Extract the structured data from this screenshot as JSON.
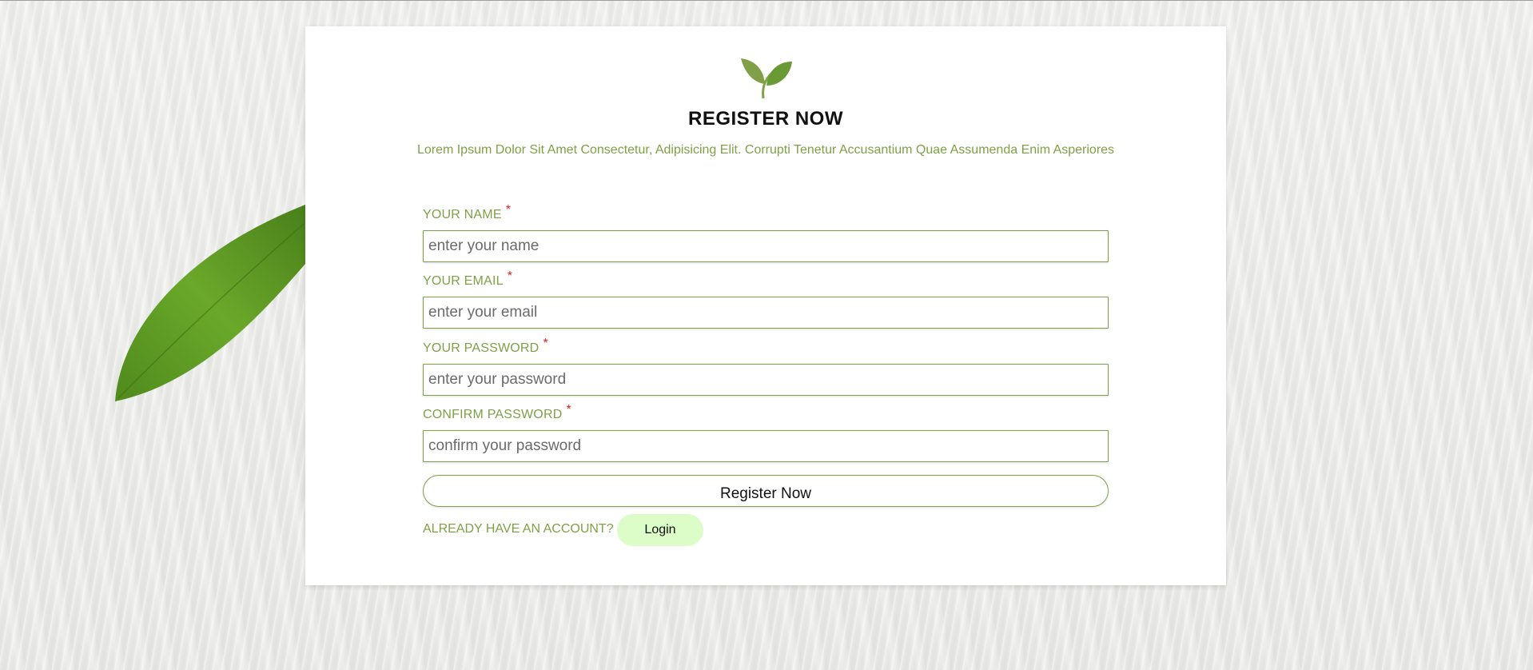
{
  "page": {
    "title": "REGISTER NOW",
    "subtitle": "Lorem Ipsum Dolor Sit Amet Consectetur, Adipisicing Elit. Corrupti Tenetur Accusantium Quae Assumenda Enim Asperiores"
  },
  "form": {
    "required_mark": "*",
    "fields": [
      {
        "label": "YOUR NAME",
        "placeholder": "enter your name",
        "value": ""
      },
      {
        "label": "YOUR EMAIL",
        "placeholder": "enter your email",
        "value": ""
      },
      {
        "label": "YOUR PASSWORD",
        "placeholder": "enter your password",
        "value": ""
      },
      {
        "label": "CONFIRM PASSWORD",
        "placeholder": "confirm your password",
        "value": ""
      }
    ],
    "submit_label": "Register Now",
    "already_text": "ALREADY HAVE AN ACCOUNT?",
    "login_label": "Login"
  },
  "icons": {
    "logo": "leaf-logo-icon",
    "decoration": "leaf-decoration"
  },
  "colors": {
    "accent": "#7fa046",
    "required": "#e0241e",
    "login_bg": "#dcfcc8",
    "card_bg": "#ffffff"
  }
}
